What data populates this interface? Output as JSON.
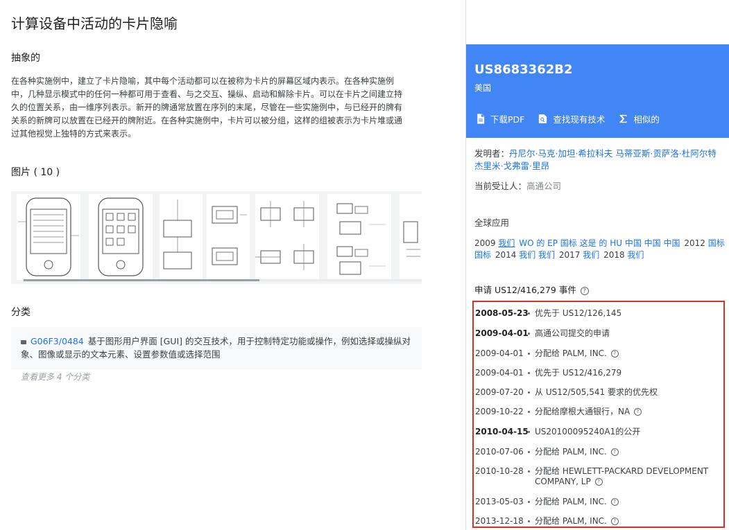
{
  "page_title": "计算设备中活动的卡片隐喻",
  "abstract": {
    "heading": "抽象的",
    "text": "在各种实施例中，建立了卡片隐喻，其中每个活动都可以在被称为卡片的屏幕区域内表示。在各种实施例中，几种显示模式中的任何一种都可用于查看、与之交互、操纵、启动和解除卡片。可以在卡片之间建立持久的位置关系，由一维序列表示。新开的牌通常放置在序列的末尾，尽管在一些实施例中，与已经开的牌有关系的新牌可以放置在已经开的牌附近。在各种实施例中，卡片可以被分组，这样的组被表示为卡片堆或通过其他视觉上独特的方式来表示。"
  },
  "figures": {
    "heading": "图片 ( 10 )"
  },
  "classification": {
    "heading": "分类",
    "code": "G06F3/0484",
    "description": "基于图形用户界面 [GUI] 的交互技术，用于控制特定功能或操作，例如选择或操纵对象、图像或显示的文本元素、设置参数值或选择范围",
    "more": "查看更多 4 个分类"
  },
  "patent": {
    "number": "US8683362B2",
    "country": "美国",
    "actions": [
      {
        "label": "下载PDF",
        "icon": "pdf-icon"
      },
      {
        "label": "查找现有技术",
        "icon": "search-icon"
      },
      {
        "label": "相似的",
        "icon": "sigma-icon"
      }
    ],
    "inventors_label": "发明者：",
    "inventors": "丹尼尔·马克·加坦·希拉科夫 马蒂亚斯·贡萨洛·杜阿尔特 杰里米·戈弗雷·里昂",
    "assignee_label": "当前受让人：",
    "assignee": "高通公司"
  },
  "world": {
    "heading": "全球应用",
    "parts": [
      {
        "text": "2009",
        "type": "plain"
      },
      {
        "text": "我们",
        "type": "link-underline"
      },
      {
        "text": "WO 的 EP 国标 这是 的 HU 中国 中国 中国",
        "type": "link"
      },
      {
        "text": "2012",
        "type": "plain"
      },
      {
        "text": "国标 国标",
        "type": "link"
      },
      {
        "text": "2014",
        "type": "plain"
      },
      {
        "text": "我们 我们",
        "type": "link"
      },
      {
        "text": "2017",
        "type": "plain"
      },
      {
        "text": "我们",
        "type": "link"
      },
      {
        "text": "2018",
        "type": "plain"
      },
      {
        "text": "我们",
        "type": "link"
      }
    ]
  },
  "events": {
    "title": "申请 US12/416,279 事件",
    "items": [
      {
        "date": "2008-05-23",
        "bold": true,
        "desc": "优先于 US12/126,145",
        "help": false
      },
      {
        "date": "2009-04-01",
        "bold": true,
        "desc": "高通公司提交的申请",
        "help": false
      },
      {
        "date": "2009-04-01",
        "bold": false,
        "desc": "分配给 PALM, INC.",
        "help": true
      },
      {
        "date": "2009-04-01",
        "bold": false,
        "desc": "优先于 US12/416,279",
        "help": false
      },
      {
        "date": "2009-07-20",
        "bold": false,
        "desc": "从 US12/505,541 要求的优先权",
        "help": false
      },
      {
        "date": "2009-10-22",
        "bold": false,
        "desc": "分配给摩根大通银行，NA",
        "help": true
      },
      {
        "date": "2010-04-15",
        "bold": true,
        "desc": "US20100095240A1的公开",
        "help": false
      },
      {
        "date": "2010-07-06",
        "bold": false,
        "desc": "分配给 PALM, INC.",
        "help": true
      },
      {
        "date": "2010-10-28",
        "bold": false,
        "desc": "分配给 HEWLETT-PACKARD DEVELOPMENT COMPANY, LP",
        "help": true
      },
      {
        "date": "2013-05-03",
        "bold": false,
        "desc": "分配给 PALM, INC.",
        "help": true
      },
      {
        "date": "2013-12-18",
        "bold": false,
        "desc": "分配给 PALM, INC.",
        "help": true
      }
    ]
  }
}
